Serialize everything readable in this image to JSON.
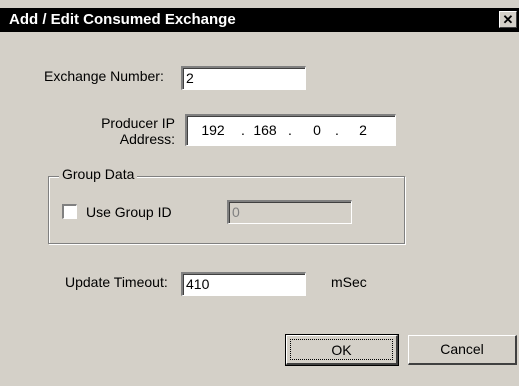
{
  "dialog": {
    "title": "Add / Edit Consumed Exchange",
    "close_icon": "close-icon",
    "close_glyph": "✕"
  },
  "exchange_number": {
    "label": "Exchange Number:",
    "value": "2"
  },
  "producer_ip": {
    "label_line1": "Producer IP",
    "label_line2": "Address:",
    "octets": [
      "192",
      "168",
      "0",
      "2"
    ],
    "separator": "."
  },
  "group_data": {
    "legend": "Group Data",
    "checkbox_label": "Use Group ID",
    "checked": false,
    "group_id_value": "0"
  },
  "update_timeout": {
    "label": "Update Timeout:",
    "value": "410",
    "unit": "mSec"
  },
  "buttons": {
    "ok": "OK",
    "cancel": "Cancel"
  },
  "colors": {
    "dialog_face": "#d4d0c8",
    "title_bar": "#000000",
    "title_text": "#ffffff"
  }
}
